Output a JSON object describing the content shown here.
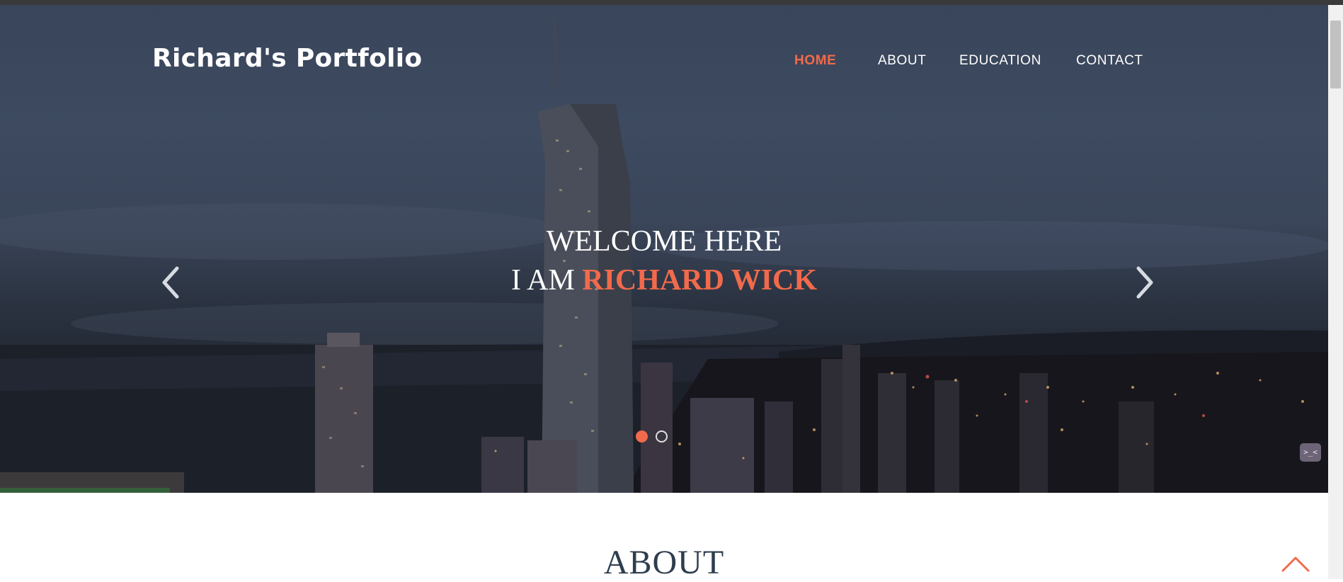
{
  "brand": {
    "title": "Richard's Portfolio"
  },
  "nav": {
    "items": [
      {
        "label": "HOME",
        "active": true
      },
      {
        "label": "ABOUT",
        "active": false
      },
      {
        "label": "EDUCATION",
        "active": false
      },
      {
        "label": "CONTACT",
        "active": false
      }
    ]
  },
  "hero": {
    "line1": "WELCOME HERE",
    "line2_prefix": "I AM",
    "line2_name": "RICHARD WICK",
    "prev_icon": "chevron-left-icon",
    "next_icon": "chevron-right-icon",
    "slide_count": 2,
    "active_slide": 1
  },
  "chat_widget": {
    "icon": "chat-face-icon",
    "glyph": ">_<"
  },
  "about": {
    "title": "ABOUT"
  },
  "scroll_top": {
    "icon": "chevron-up-icon"
  },
  "colors": {
    "accent": "#f26a4b",
    "text_light": "#ffffff",
    "heading_dark": "#2f3e4e"
  }
}
